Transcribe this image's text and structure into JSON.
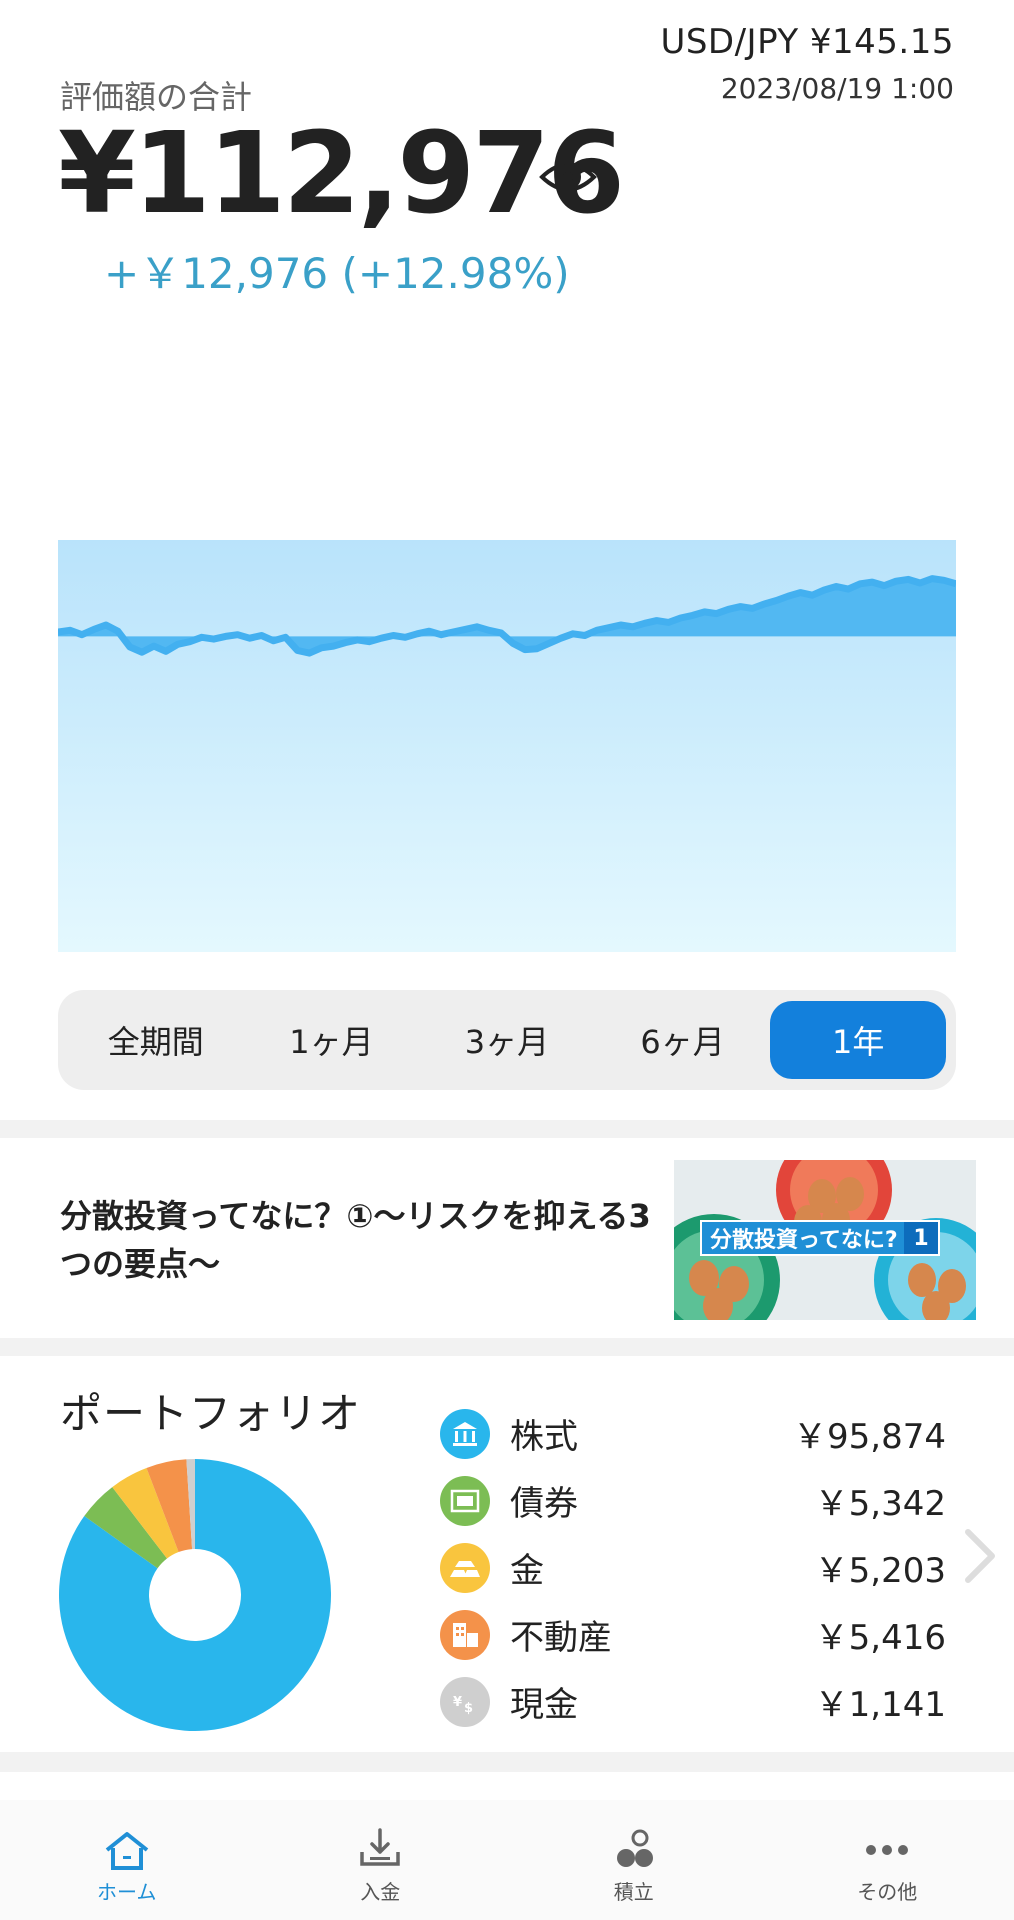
{
  "header": {
    "fx_rate": "USD/JPY ¥145.15",
    "timestamp": "2023/08/19 1:00",
    "total_label": "評価額の合計",
    "total_value": "¥112,976",
    "gain": "+￥12,976 (+12.98%)"
  },
  "periods": [
    {
      "label": "全期間",
      "active": false
    },
    {
      "label": "1ヶ月",
      "active": false
    },
    {
      "label": "3ヶ月",
      "active": false
    },
    {
      "label": "6ヶ月",
      "active": false
    },
    {
      "label": "1年",
      "active": true
    }
  ],
  "article": {
    "title": "分散投資ってなに？①〜リスクを抑える3つの要点〜",
    "thumb_text": "分散投資ってなに?",
    "thumb_num": "1"
  },
  "portfolio": {
    "title": "ポートフォリオ",
    "assets": [
      {
        "name": "株式",
        "value": "￥95,874",
        "amount": 95874,
        "color": "#29b6ec",
        "icon": "bank-icon"
      },
      {
        "name": "債券",
        "value": "￥5,342",
        "amount": 5342,
        "color": "#7cbd54",
        "icon": "bond-certificate-icon"
      },
      {
        "name": "金",
        "value": "￥5,203",
        "amount": 5203,
        "color": "#f9c53e",
        "icon": "gold-bars-icon"
      },
      {
        "name": "不動産",
        "value": "￥5,416",
        "amount": 5416,
        "color": "#f4924a",
        "icon": "buildings-icon"
      },
      {
        "name": "現金",
        "value": "￥1,141",
        "amount": 1141,
        "color": "#cfcfcf",
        "icon": "cash-icon"
      }
    ]
  },
  "tabbar": [
    {
      "label": "ホーム",
      "icon": "home-icon",
      "active": true
    },
    {
      "label": "入金",
      "icon": "deposit-icon",
      "active": false
    },
    {
      "label": "積立",
      "icon": "savings-icon",
      "active": false
    },
    {
      "label": "その他",
      "icon": "more-icon",
      "active": false
    }
  ],
  "colors": {
    "accent": "#1380dc",
    "gain": "#3aa0c8",
    "chart_line": "#43b0f0"
  },
  "chart_data": {
    "type": "area",
    "title": "",
    "xlabel": "",
    "ylabel": "",
    "values": [
      101500,
      101700,
      101200,
      101800,
      102300,
      101600,
      99800,
      99200,
      99900,
      99300,
      100100,
      100400,
      100900,
      100700,
      101000,
      101200,
      100800,
      101100,
      100500,
      100900,
      99400,
      99100,
      99700,
      99900,
      100300,
      100600,
      100400,
      100800,
      101100,
      100900,
      101300,
      101600,
      101200,
      101500,
      101800,
      102100,
      101700,
      101400,
      100200,
      99500,
      99600,
      100200,
      100800,
      101300,
      101100,
      101700,
      102000,
      102300,
      102100,
      102500,
      102800,
      102600,
      103100,
      103400,
      103800,
      103600,
      104100,
      104400,
      104200,
      104700,
      105100,
      105600,
      106000,
      105700,
      106300,
      106700,
      106400,
      107000,
      107200,
      106800,
      107300,
      107500,
      107100,
      107600,
      107400,
      107000
    ],
    "baseline": 101000,
    "ylim": [
      65000,
      112000
    ]
  }
}
